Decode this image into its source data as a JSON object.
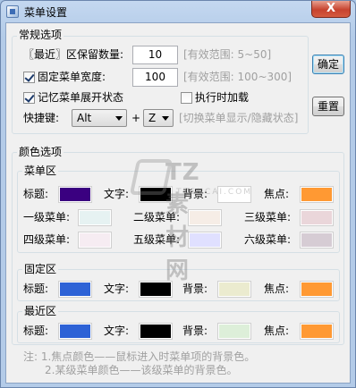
{
  "window": {
    "title": "菜单设置",
    "close_glyph": "X"
  },
  "general": {
    "group_label": "常规选项",
    "recent_count_label": "〖最近〗区保留数量:",
    "recent_count_value": "10",
    "recent_count_hint": "[有效范围: 5~50]",
    "fixed_width_label": "固定菜单宽度:",
    "fixed_width_checked": true,
    "fixed_width_value": "100",
    "fixed_width_hint": "[有效范围: 100~300]",
    "remember_expand_label": "记忆菜单展开状态",
    "remember_expand_checked": true,
    "load_on_run_label": "执行时加载",
    "load_on_run_checked": false,
    "hotkey_label": "快捷键:",
    "hotkey_modifier": "Alt",
    "hotkey_plus": "+",
    "hotkey_key": "Z",
    "hotkey_hint": "[切换菜单显示/隐藏状态]"
  },
  "buttons": {
    "ok": "确定",
    "reset": "重置"
  },
  "colors": {
    "group_label": "颜色选项",
    "menu_area": {
      "label": "菜单区",
      "title_label": "标题:",
      "title_color": "#3a0080",
      "text_label": "文字:",
      "text_color": "#000000",
      "bg_label": "背景:",
      "bg_color": "#ffffff",
      "focus_label": "焦点:",
      "focus_color": "#ff9933",
      "level1_label": "一级菜单:",
      "level1_color": "#e6f2f2",
      "level2_label": "二级菜单:",
      "level2_color": "#f6ede6",
      "level3_label": "三级菜单:",
      "level3_color": "#ead6da",
      "level4_label": "四级菜单:",
      "level4_color": "#f6ecf2",
      "level5_label": "五级菜单:",
      "level5_color": "#e0e0ff",
      "level6_label": "六级菜单:",
      "level6_color": "#d6ccd4"
    },
    "fixed_area": {
      "label": "固定区",
      "title_label": "标题:",
      "title_color": "#2d62d6",
      "text_label": "文字:",
      "text_color": "#000000",
      "bg_label": "背景:",
      "bg_color": "#ebebcf",
      "focus_label": "焦点:",
      "focus_color": "#ff9933"
    },
    "recent_area": {
      "label": "最近区",
      "title_label": "标题:",
      "title_color": "#2d62d6",
      "text_label": "文字:",
      "text_color": "#000000",
      "bg_label": "背景:",
      "bg_color": "#ddefd9",
      "focus_label": "焦点:",
      "focus_color": "#ff9933"
    }
  },
  "notes": {
    "line1": "注: 1.焦点颜色——鼠标进入时菜单项的背景色。",
    "line2": "2.某级菜单颜色——该级菜单的背景色。"
  },
  "watermark": {
    "brand": "TZ素材网",
    "url": "TZSUCAI.COM"
  }
}
